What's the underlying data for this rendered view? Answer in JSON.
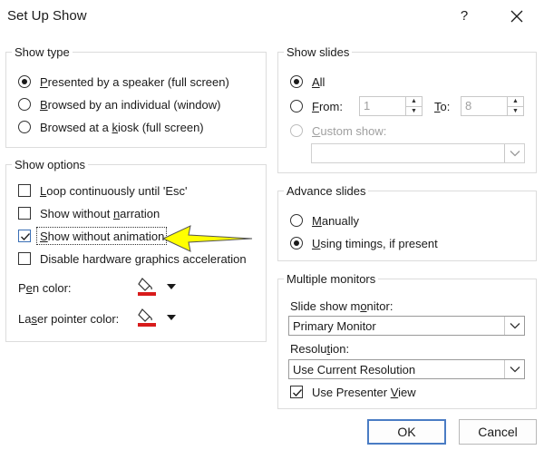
{
  "window": {
    "title": "Set Up Show",
    "help": "?"
  },
  "show_type": {
    "label": "Show type",
    "options": [
      {
        "pre": "",
        "key": "P",
        "post": "resented by a speaker (full screen)",
        "checked": true
      },
      {
        "pre": "",
        "key": "B",
        "post": "rowsed by an individual (window)",
        "checked": false
      },
      {
        "pre": "Browsed at a ",
        "key": "k",
        "post": "iosk (full screen)",
        "checked": false
      }
    ]
  },
  "show_options": {
    "label": "Show options",
    "checks": [
      {
        "pre": "",
        "key": "L",
        "post": "oop continuously until 'Esc'",
        "checked": false
      },
      {
        "pre": "Show without ",
        "key": "n",
        "post": "arration",
        "checked": false
      },
      {
        "pre": "",
        "key": "S",
        "post": "how without animation",
        "checked": true
      },
      {
        "pre": "Disable hardware ",
        "key": "g",
        "post": "raphics acceleration",
        "checked": false
      }
    ],
    "pen_color": {
      "pre": "P",
      "key": "e",
      "post": "n color:"
    },
    "laser_color": {
      "pre": "La",
      "key": "s",
      "post": "er pointer color:"
    },
    "accent": "#d81b1b"
  },
  "show_slides": {
    "label": "Show slides",
    "all": {
      "pre": "",
      "key": "A",
      "post": "ll",
      "checked": true
    },
    "from": {
      "pre": "",
      "key": "F",
      "post": "rom:",
      "checked": false,
      "value": "1"
    },
    "to": {
      "pre": "",
      "key": "T",
      "post": "o:",
      "value": "8"
    },
    "custom": {
      "pre": "",
      "key": "C",
      "post": "ustom show:",
      "value": ""
    }
  },
  "advance_slides": {
    "label": "Advance slides",
    "manually": {
      "pre": "",
      "key": "M",
      "post": "anually",
      "checked": false
    },
    "timings": {
      "pre": "",
      "key": "U",
      "post": "sing timings, if present",
      "checked": true
    }
  },
  "monitors": {
    "label": "Multiple monitors",
    "monitor_label": {
      "pre": "Slide show m",
      "key": "o",
      "post": "nitor:"
    },
    "monitor_value": "Primary Monitor",
    "resolution_label": {
      "pre": "Resolu",
      "key": "t",
      "post": "ion:"
    },
    "resolution_value": "Use Current Resolution",
    "presenter": {
      "pre": "Use Presenter ",
      "key": "V",
      "post": "iew",
      "checked": true
    }
  },
  "buttons": {
    "ok": "OK",
    "cancel": "Cancel"
  },
  "annotation": {
    "arrow_color": "#ffff00",
    "arrow_stroke": "#555555"
  }
}
